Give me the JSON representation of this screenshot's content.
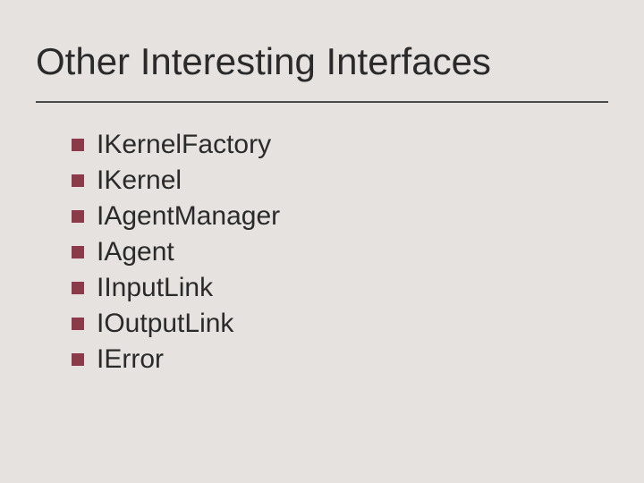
{
  "slide": {
    "title": "Other Interesting Interfaces",
    "items": [
      {
        "label": "IKernelFactory"
      },
      {
        "label": "IKernel"
      },
      {
        "label": "IAgentManager"
      },
      {
        "label": "IAgent"
      },
      {
        "label": "IInputLink"
      },
      {
        "label": "IOutputLink"
      },
      {
        "label": "IError"
      }
    ]
  }
}
